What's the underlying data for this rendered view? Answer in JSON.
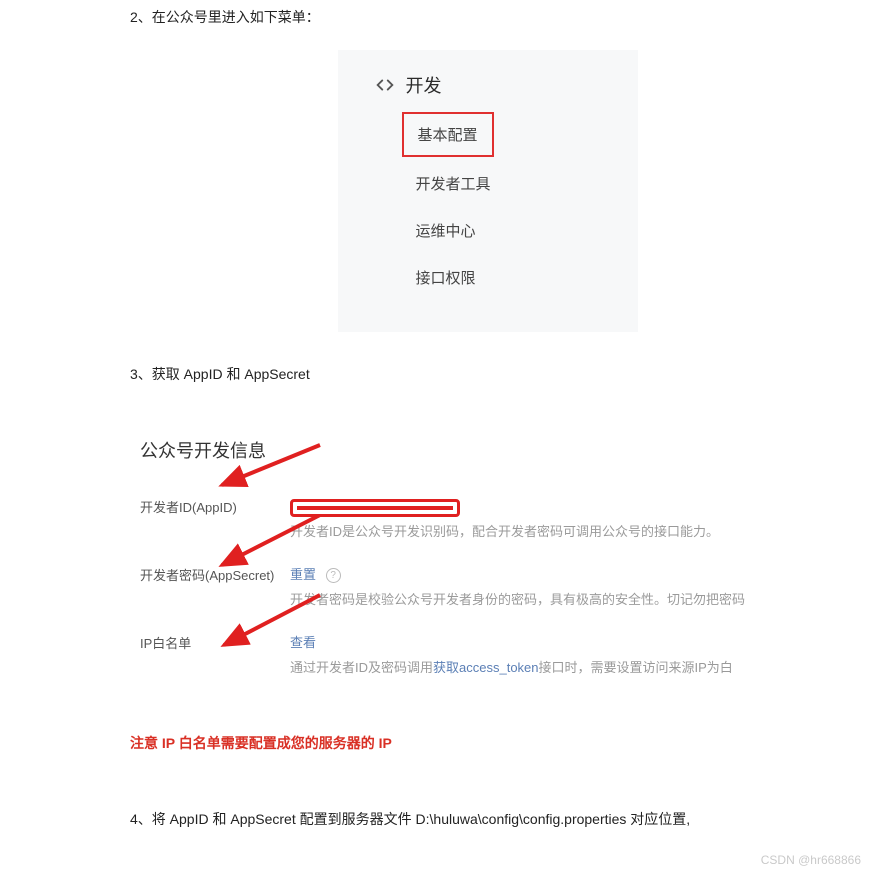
{
  "steps": {
    "s2": "2、在公众号里进入如下菜单：",
    "s3": "3、获取 AppID 和 AppSecret",
    "s4": "4、将 AppID 和 AppSecret 配置到服务器文件  D:\\huluwa\\config\\config.properties  对应位置,"
  },
  "menu": {
    "section_title": "开发",
    "items": [
      "基本配置",
      "开发者工具",
      "运维中心",
      "接口权限"
    ],
    "highlighted_index": 0
  },
  "dev_info": {
    "panel_title": "公众号开发信息",
    "rows": {
      "appid": {
        "label": "开发者ID(AppID)",
        "desc": "开发者ID是公众号开发识别码，配合开发者密码可调用公众号的接口能力。"
      },
      "secret": {
        "label": "开发者密码(AppSecret)",
        "reset": "重置",
        "desc": "开发者密码是校验公众号开发者身份的密码，具有极高的安全性。切记勿把密码"
      },
      "ip": {
        "label": "IP白名单",
        "view": "查看",
        "desc_pre": "通过开发者ID及密码调用",
        "desc_link": "获取access_token",
        "desc_post": "接口时，需要设置访问来源IP为白"
      }
    }
  },
  "warning": "注意 IP 白名单需要配置成您的服务器的 IP",
  "watermark": "CSDN @hr668866"
}
